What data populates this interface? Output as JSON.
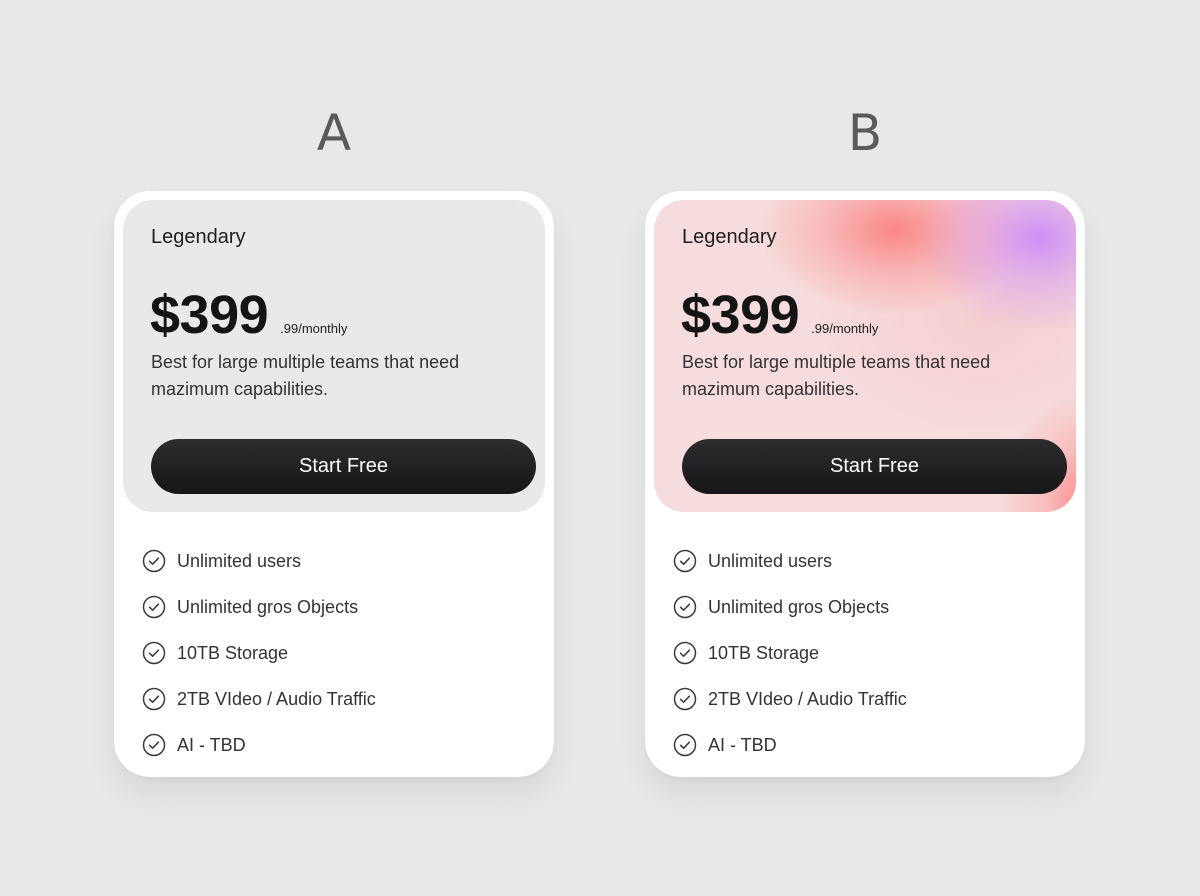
{
  "variants": [
    {
      "label": "A",
      "plan_name": "Legendary",
      "price": "$399",
      "price_suffix": ".99/monthly",
      "description": "Best for large multiple teams that need mazimum capabilities.",
      "cta_label": "Start Free",
      "features": [
        {
          "icon": "check-circle-icon",
          "label": "Unlimited users"
        },
        {
          "icon": "check-circle-icon",
          "label": "Unlimited gros Objects"
        },
        {
          "icon": "check-circle-icon",
          "label": "10TB Storage"
        },
        {
          "icon": "check-circle-icon",
          "label": "2TB VIdeo / Audio Traffic"
        },
        {
          "icon": "check-circle-icon",
          "label": "AI - TBD"
        }
      ],
      "panel_background": "#e9e9e9"
    },
    {
      "label": "B",
      "plan_name": "Legendary",
      "price": "$399",
      "price_suffix": ".99/monthly",
      "description": "Best for large multiple teams that need mazimum capabilities.",
      "cta_label": "Start Free",
      "features": [
        {
          "icon": "check-circle-icon",
          "label": "Unlimited users"
        },
        {
          "icon": "check-circle-icon",
          "label": "Unlimited gros Objects"
        },
        {
          "icon": "check-circle-icon",
          "label": "10TB Storage"
        },
        {
          "icon": "check-circle-icon",
          "label": "2TB VIdeo / Audio Traffic"
        },
        {
          "icon": "check-circle-icon",
          "label": "AI - TBD"
        }
      ],
      "panel_background": "gradient: pink #f6dcdc, coral #fa7878, lavender #cc8cf6"
    }
  ],
  "colors": {
    "page_background": "#e8e8e8",
    "card_background": "#ffffff",
    "button_background": "#1a191b",
    "button_text": "#ffffff",
    "text_primary": "#141414",
    "text_secondary": "#333333"
  }
}
